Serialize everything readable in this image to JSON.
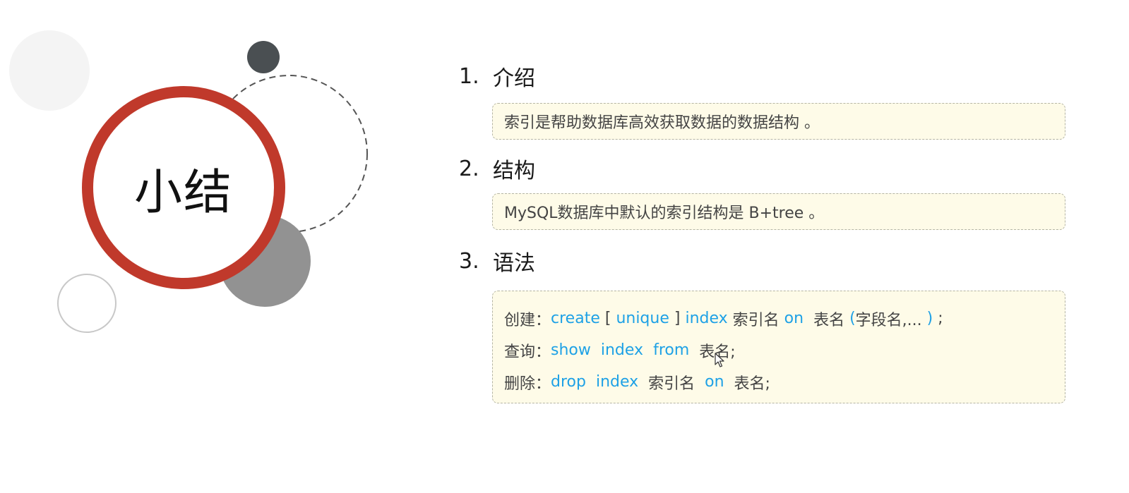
{
  "slide_title": "小结",
  "sections": [
    {
      "num": "1.",
      "heading": "介绍",
      "content": "索引是帮助数据库高效获取数据的数据结构 。"
    },
    {
      "num": "2.",
      "heading": "结构",
      "content": "MySQL数据库中默认的索引结构是 B+tree 。"
    },
    {
      "num": "3.",
      "heading": "语法"
    }
  ],
  "syntax": {
    "create": {
      "label": "创建：",
      "kw1": "create",
      "open": " [ ",
      "kw2": "unique",
      "close": " ] ",
      "kw3": "index",
      "t1": " 索引名 ",
      "kw4": "on",
      "t2": "  表名 ",
      "kw5": "(",
      "t3": "字段名,... ",
      "kw6": ")",
      "t4": " ;"
    },
    "show": {
      "label": "查询：",
      "kw1": "show",
      "kw2": "index",
      "kw3": "from",
      "t1": "  表名;"
    },
    "drop": {
      "label": "删除：",
      "kw1": "drop",
      "kw2": "index",
      "t1": "  索引名  ",
      "kw3": "on",
      "t2": "  表名;"
    }
  },
  "colors": {
    "accent_red": "#c0392b",
    "keyword_blue": "#1ea1e6",
    "box_background": "#fefbe8"
  }
}
